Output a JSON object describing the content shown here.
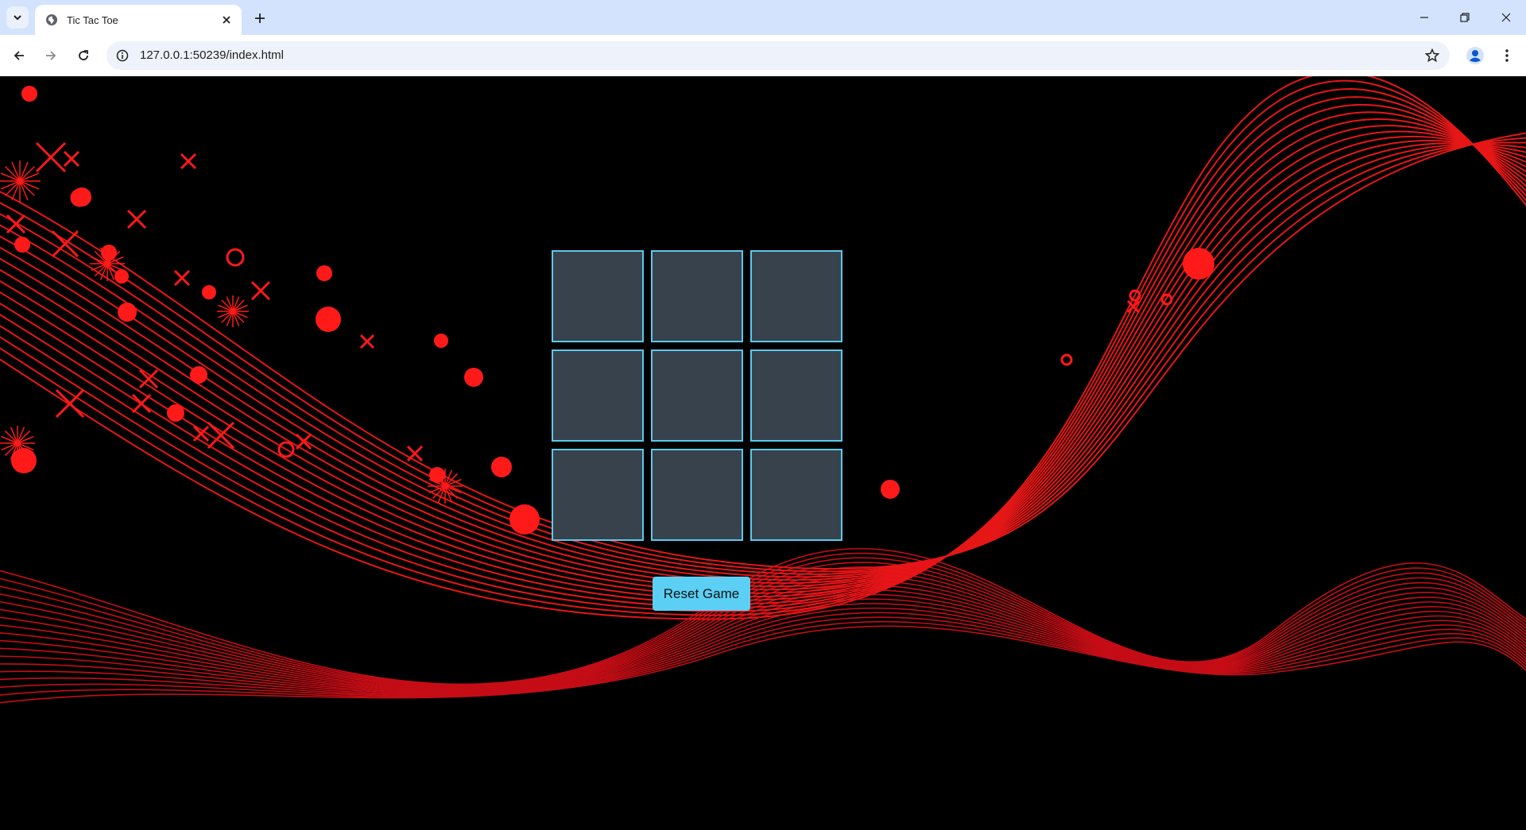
{
  "browser": {
    "tab_title": "Tic Tac Toe",
    "url": "127.0.0.1:50239/index.html"
  },
  "game": {
    "cells": [
      "",
      "",
      "",
      "",
      "",
      "",
      "",
      "",
      ""
    ],
    "reset_label": "Reset Game"
  },
  "colors": {
    "background": "#000000",
    "cell_fill": "#37424d",
    "cell_border": "#5cc8ea",
    "button": "#5bcff4",
    "decor": "#ff1a1a"
  }
}
